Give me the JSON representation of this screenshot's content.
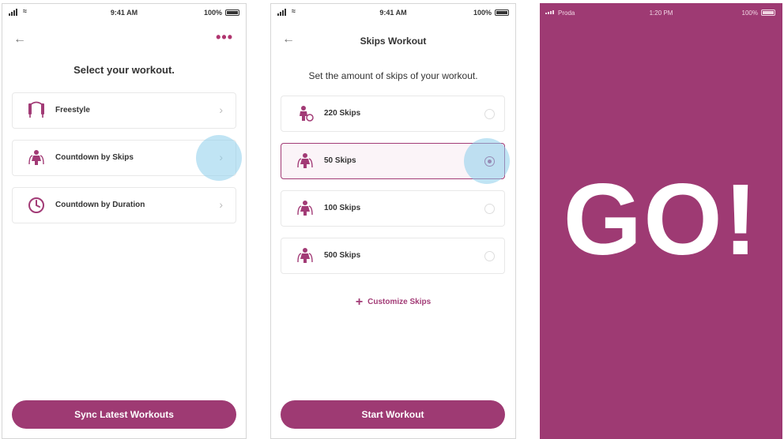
{
  "colors": {
    "accent": "#9e3a73",
    "tap_highlight": "#8ccdeb"
  },
  "screen1": {
    "status": {
      "time": "9:41 AM",
      "battery": "100%"
    },
    "heading": "Select your workout.",
    "options": [
      {
        "label": "Freestyle",
        "icon": "rope-icon"
      },
      {
        "label": "Countdown by Skips",
        "icon": "jumper-icon"
      },
      {
        "label": "Countdown by Duration",
        "icon": "clock-icon"
      }
    ],
    "button": "Sync Latest Workouts"
  },
  "screen2": {
    "status": {
      "time": "9:41 AM",
      "battery": "100%"
    },
    "title": "Skips Workout",
    "heading": "Set the amount of skips of your workout.",
    "options": [
      {
        "label": "220 Skips",
        "icon": "jumper-icon",
        "selected": false
      },
      {
        "label": "50 Skips",
        "icon": "jumper-icon",
        "selected": true
      },
      {
        "label": "100 Skips",
        "icon": "jumper-icon",
        "selected": false
      },
      {
        "label": "500 Skips",
        "icon": "jumper-icon",
        "selected": false
      }
    ],
    "customize": "Customize Skips",
    "button": "Start Workout"
  },
  "screen3": {
    "status": {
      "carrier": "Proda",
      "time": "1:20 PM",
      "battery": "100%"
    },
    "go": "GO!"
  }
}
